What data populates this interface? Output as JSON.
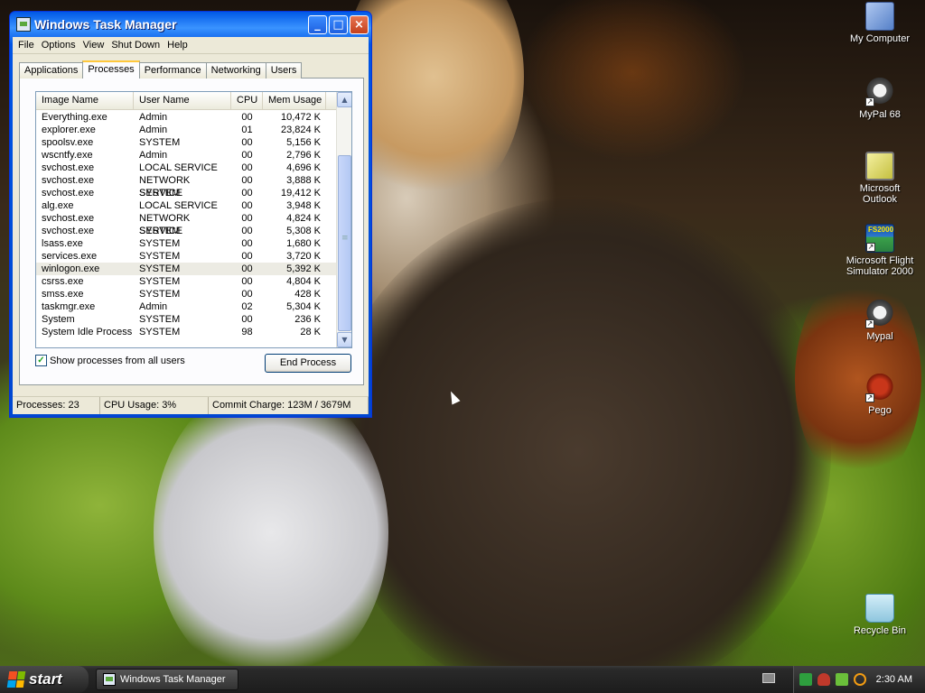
{
  "window": {
    "title": "Windows Task Manager",
    "controls": {
      "minimize": "_",
      "maximize": "□",
      "close": "×"
    }
  },
  "menu": [
    "File",
    "Options",
    "View",
    "Shut Down",
    "Help"
  ],
  "tabs": [
    {
      "label": "Applications",
      "active": false
    },
    {
      "label": "Processes",
      "active": true
    },
    {
      "label": "Performance",
      "active": false
    },
    {
      "label": "Networking",
      "active": false
    },
    {
      "label": "Users",
      "active": false
    }
  ],
  "table": {
    "columns": [
      "Image Name",
      "User Name",
      "CPU",
      "Mem Usage"
    ],
    "rows": [
      [
        "Everything.exe",
        "Admin",
        "00",
        "10,472 K"
      ],
      [
        "explorer.exe",
        "Admin",
        "01",
        "23,824 K"
      ],
      [
        "spoolsv.exe",
        "SYSTEM",
        "00",
        "5,156 K"
      ],
      [
        "wscntfy.exe",
        "Admin",
        "00",
        "2,796 K"
      ],
      [
        "svchost.exe",
        "LOCAL SERVICE",
        "00",
        "4,696 K"
      ],
      [
        "svchost.exe",
        "NETWORK SERVICE",
        "00",
        "3,888 K"
      ],
      [
        "svchost.exe",
        "SYSTEM",
        "00",
        "19,412 K"
      ],
      [
        "alg.exe",
        "LOCAL SERVICE",
        "00",
        "3,948 K"
      ],
      [
        "svchost.exe",
        "NETWORK SERVICE",
        "00",
        "4,824 K"
      ],
      [
        "svchost.exe",
        "SYSTEM",
        "00",
        "5,308 K"
      ],
      [
        "lsass.exe",
        "SYSTEM",
        "00",
        "1,680 K"
      ],
      [
        "services.exe",
        "SYSTEM",
        "00",
        "3,720 K"
      ],
      [
        "winlogon.exe",
        "SYSTEM",
        "00",
        "5,392 K"
      ],
      [
        "csrss.exe",
        "SYSTEM",
        "00",
        "4,804 K"
      ],
      [
        "smss.exe",
        "SYSTEM",
        "00",
        "428 K"
      ],
      [
        "taskmgr.exe",
        "Admin",
        "02",
        "5,304 K"
      ],
      [
        "System",
        "SYSTEM",
        "00",
        "236 K"
      ],
      [
        "System Idle Process",
        "SYSTEM",
        "98",
        "28 K"
      ]
    ],
    "selected_row": 12
  },
  "show_all_processes": {
    "label": "Show processes from all users",
    "checked": true
  },
  "end_process_label": "End Process",
  "status": {
    "processes": "Processes: 23",
    "cpu": "CPU Usage: 3%",
    "commit": "Commit Charge: 123M / 3679M"
  },
  "desktop_icons": [
    {
      "label": "My Computer",
      "icon": "computer-icon"
    },
    {
      "label": "MyPal 68",
      "icon": "raccoon-icon"
    },
    {
      "label": "Microsoft Outlook",
      "icon": "outlook-icon"
    },
    {
      "label": "Microsoft Flight Simulator 2000",
      "icon": "flight-sim-icon",
      "badge": "FS2000"
    },
    {
      "label": "Mypal",
      "icon": "raccoon-icon"
    },
    {
      "label": "Pego",
      "icon": "pego-icon"
    },
    {
      "label": "Recycle Bin",
      "icon": "recycle-bin-icon"
    }
  ],
  "taskbar": {
    "start_label": "start",
    "task_label": "Windows Task Manager",
    "clock": "2:30 AM"
  }
}
